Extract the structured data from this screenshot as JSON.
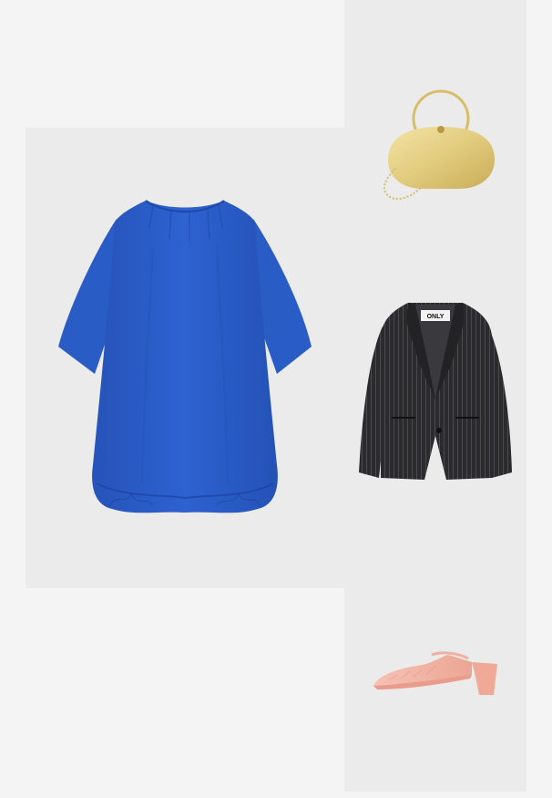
{
  "outfit": {
    "background_color": "#f4f4f4",
    "tile_color": "#ebebeb",
    "items": [
      {
        "key": "dress",
        "icon": "blue-dress-image",
        "color": "#2a5cc7"
      },
      {
        "key": "bag",
        "icon": "gold-handbag-image",
        "color": "#e2cf86"
      },
      {
        "key": "blazer",
        "icon": "pinstripe-blazer-image",
        "color": "#2b2b2d"
      },
      {
        "key": "shoe",
        "icon": "pink-mule-image",
        "color": "#f2b2a4"
      }
    ],
    "blazer_label_text": "ONLY"
  }
}
